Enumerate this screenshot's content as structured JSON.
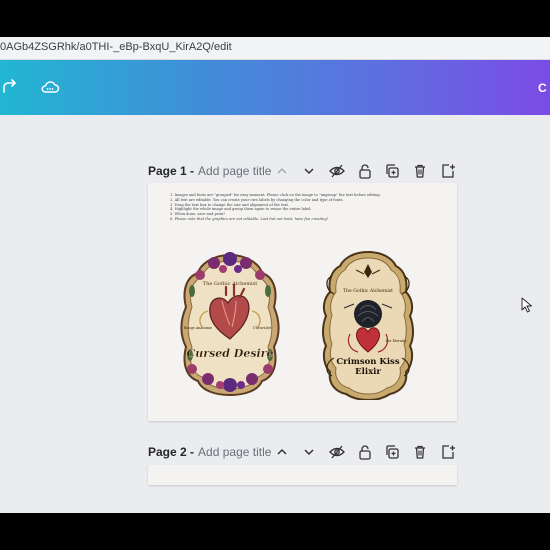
{
  "browser": {
    "url": "0AGb4ZSGRhk/a0THI-_eBp-BxqU_KirA2Q/edit"
  },
  "toolbar": {
    "share_label": "C",
    "icons": [
      "redo-icon",
      "cloud-sync-icon"
    ]
  },
  "pages": [
    {
      "number_label": "Page 1 -",
      "title_placeholder": "Add page title"
    },
    {
      "number_label": "Page 2 -",
      "title_placeholder": "Add page title"
    }
  ],
  "page_controls": [
    "chevron-up-icon",
    "chevron-down-icon",
    "hide-icon",
    "lock-icon",
    "duplicate-icon",
    "trash-icon",
    "add-page-icon"
  ],
  "instructions": [
    "1. Images and fonts are \"grouped\" for easy moment. Please click on the image to \"ungroup\" the text before editing.",
    "2. All text are editable. You can create your own labels by changing the color and type of fonts.",
    "3. Drag the text box to change the size and alignment of the text.",
    "4. Highlight the whole image and group them again to resize the entire label.",
    "5. When done, save and print!",
    "6. Please note that the graphics are not editable. Last but not least, have fun creating!"
  ],
  "labels": [
    {
      "brand": "The Gothic Alchemist",
      "name": "Cursed Desire",
      "left_note": "Rouge Anatomie",
      "right_note": "Ultraviolet"
    },
    {
      "brand": "The Gothic Alchemist",
      "name_line1": "Crimson Kiss",
      "name_line2": "Elixir",
      "note": "For Eternity"
    }
  ],
  "colors": {
    "accent_gradient_start": "#22b6d3",
    "accent_gradient_end": "#7b4be6",
    "canvas_bg": "#ebecf0"
  }
}
